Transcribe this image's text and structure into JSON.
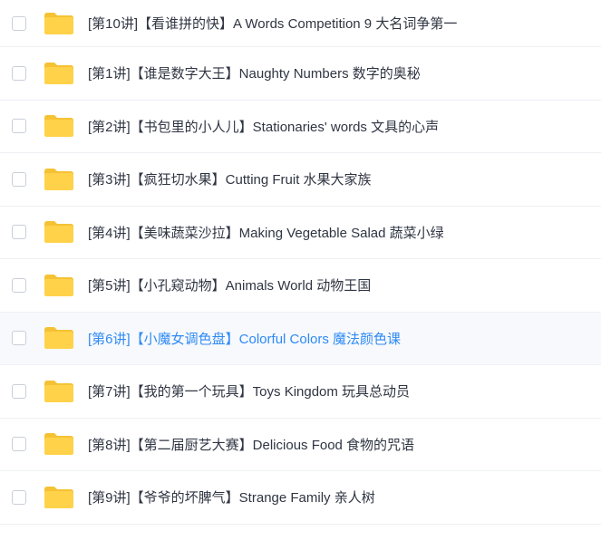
{
  "colors": {
    "folder": "#ffd24a",
    "folder_tab": "#f5c234",
    "text": "#2f3542",
    "highlight_text": "#2f8af5",
    "divider": "#eef0f4"
  },
  "files": [
    {
      "name": "[第10讲]【看谁拼的快】A Words Competition  9 大名词争第一",
      "icon": "folder-icon",
      "hovered": false
    },
    {
      "name": "[第1讲]【谁是数字大王】Naughty Numbers 数字的奥秘",
      "icon": "folder-icon",
      "hovered": false
    },
    {
      "name": "[第2讲]【书包里的小人儿】Stationaries' words 文具的心声",
      "icon": "folder-icon",
      "hovered": false
    },
    {
      "name": "[第3讲]【疯狂切水果】Cutting Fruit 水果大家族",
      "icon": "folder-icon",
      "hovered": false
    },
    {
      "name": "[第4讲]【美味蔬菜沙拉】Making Vegetable Salad 蔬菜小绿",
      "icon": "folder-icon",
      "hovered": false
    },
    {
      "name": "[第5讲]【小孔窥动物】Animals World 动物王国",
      "icon": "folder-icon",
      "hovered": false
    },
    {
      "name": "[第6讲]【小魔女调色盘】Colorful Colors 魔法颜色课",
      "icon": "folder-icon",
      "hovered": true
    },
    {
      "name": "[第7讲]【我的第一个玩具】Toys Kingdom 玩具总动员",
      "icon": "folder-icon",
      "hovered": false
    },
    {
      "name": "[第8讲]【第二届厨艺大赛】Delicious Food 食物的咒语",
      "icon": "folder-icon",
      "hovered": false
    },
    {
      "name": "[第9讲]【爷爷的坏脾气】Strange Family 亲人树",
      "icon": "folder-icon",
      "hovered": false
    }
  ]
}
